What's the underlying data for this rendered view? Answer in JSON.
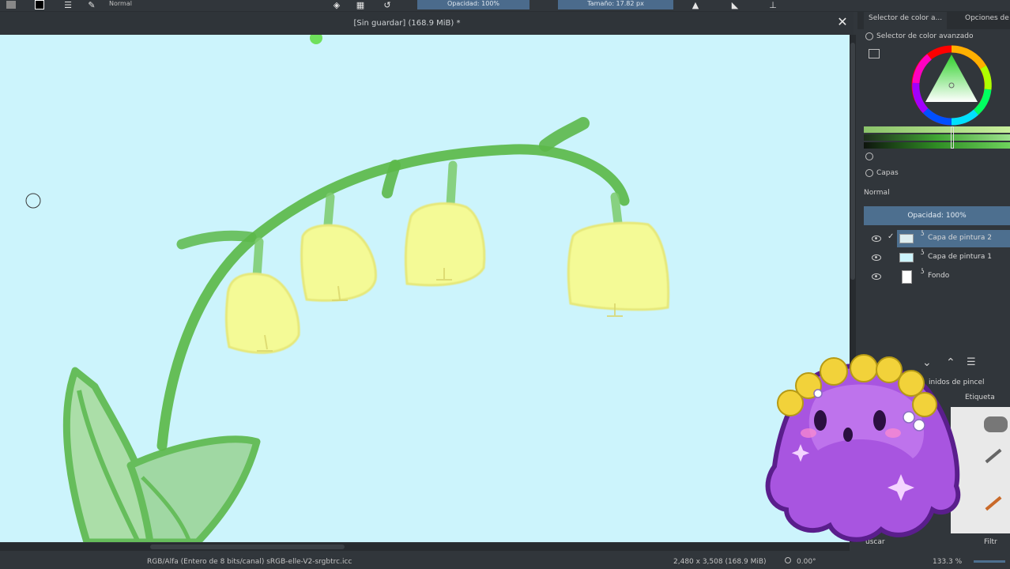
{
  "toolbar": {
    "blend_mode": "Normal",
    "opacity": "Opacidad: 100%",
    "size": "Tamaño: 17.82 px"
  },
  "document": {
    "title": "[Sin guardar]  (168.9 MiB) *",
    "close_glyph": "✕"
  },
  "dock": {
    "tabs": [
      "Selector de color a...",
      "Opciones de"
    ],
    "color_selector_title": "Selector de color avanzado",
    "layers_title": "Capas",
    "blend_mode": "Normal",
    "opacity": "Opacidad:  100%",
    "layers": [
      {
        "name": "Capa de pintura 2",
        "selected": true
      },
      {
        "name": "Capa de pintura 1",
        "selected": false
      },
      {
        "name": "Fondo",
        "selected": false
      }
    ],
    "brush_presets_label": "inidos de pincel",
    "tag_label": "Etiqueta",
    "search_label": "uscar",
    "filter_label": "Filtr"
  },
  "status": {
    "color_space": "RGB/Alfa (Entero de 8 bits/canal)  sRGB-elle-V2-srgbtrc.icc",
    "dimensions": "2,480 x 3,508 (168.9 MiB)",
    "rotation": "0.00°",
    "zoom": "133.3 %"
  },
  "colors": {
    "canvas_bg": "#ccf4fc",
    "stem_green": "#5cb84a",
    "flower_fill": "#f4fa96",
    "flower_outline": "#e6e87a",
    "accent": "#4d6f8f"
  }
}
